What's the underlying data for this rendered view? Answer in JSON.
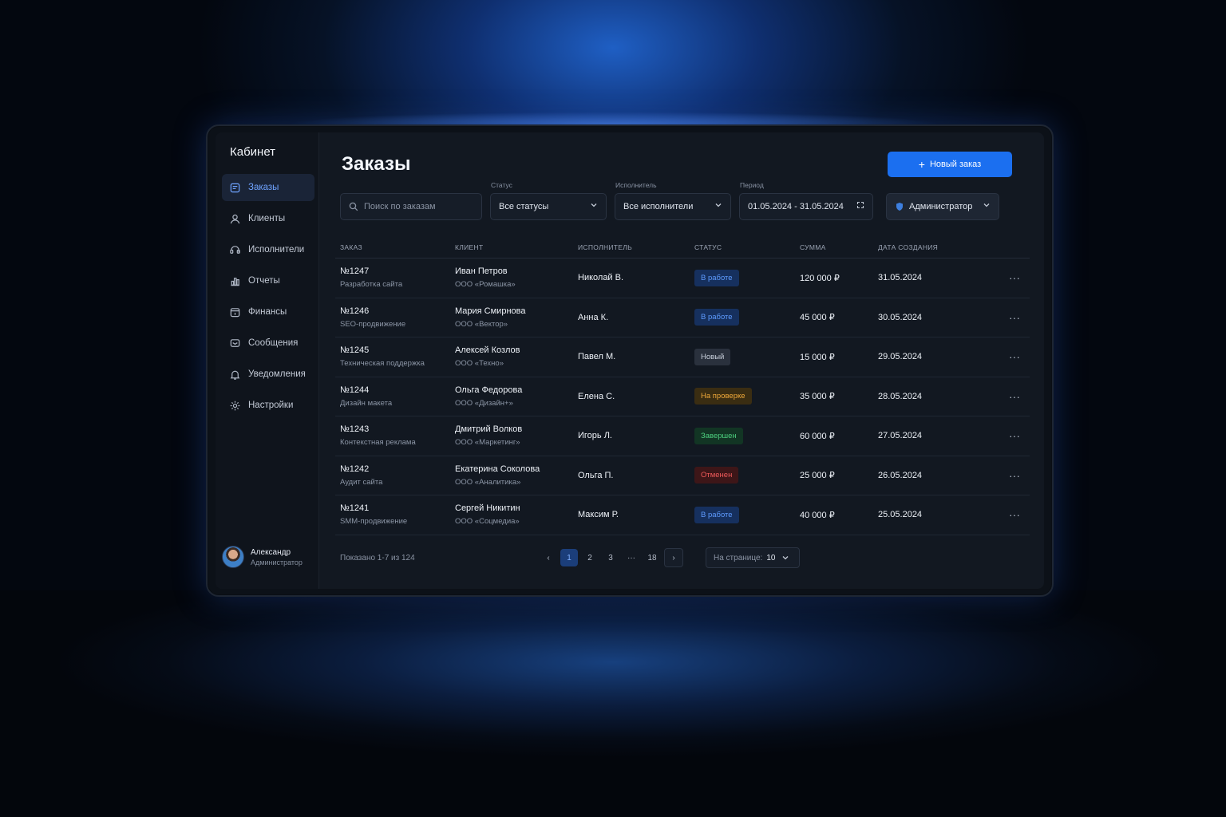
{
  "sidebar": {
    "brand": "Кабинет",
    "items": [
      {
        "label": "Заказы",
        "icon": "orders-icon",
        "active": true
      },
      {
        "label": "Клиенты",
        "icon": "clients-icon"
      },
      {
        "label": "Исполнители",
        "icon": "executors-icon"
      },
      {
        "label": "Отчеты",
        "icon": "reports-icon"
      },
      {
        "label": "Финансы",
        "icon": "finance-icon"
      },
      {
        "label": "Сообщения",
        "icon": "messages-icon"
      },
      {
        "label": "Уведомления",
        "icon": "bell-icon"
      },
      {
        "label": "Настройки",
        "icon": "gear-icon"
      }
    ],
    "user": {
      "name": "Александр",
      "role": "Администратор"
    }
  },
  "header": {
    "title": "Заказы",
    "new_button": "Новый заказ"
  },
  "filters": {
    "search_placeholder": "Поиск по заказам",
    "status_label": "Статус",
    "status_value": "Все статусы",
    "executor_label": "Исполнитель",
    "executor_value": "Все исполнители",
    "period_label": "Период",
    "period_value": "01.05.2024 - 31.05.2024",
    "role_value": "Администратор"
  },
  "table": {
    "columns": [
      "ЗАКАЗ",
      "КЛИЕНТ",
      "ИСПОЛНИТЕЛЬ",
      "СТАТУС",
      "СУММА",
      "ДАТА СОЗДАНИЯ"
    ],
    "rows": [
      {
        "id": "№1247",
        "desc": "Разработка сайта",
        "client": "Иван Петров",
        "company": "ООО «Ромашка»",
        "executor": "Николай В.",
        "status": "В работе",
        "amount": "120 000 ₽",
        "date": "31.05.2024"
      },
      {
        "id": "№1246",
        "desc": "SEO-продвижение",
        "client": "Мария Смирнова",
        "company": "ООО «Вектор»",
        "executor": "Анна К.",
        "status": "В работе",
        "amount": "45 000 ₽",
        "date": "30.05.2024"
      },
      {
        "id": "№1245",
        "desc": "Техническая поддержка",
        "client": "Алексей Козлов",
        "company": "ООО «Техно»",
        "executor": "Павел М.",
        "status": "Новый",
        "amount": "15 000 ₽",
        "date": "29.05.2024"
      },
      {
        "id": "№1244",
        "desc": "Дизайн макета",
        "client": "Ольга Федорова",
        "company": "ООО «Дизайн+»",
        "executor": "Елена С.",
        "status": "На проверке",
        "amount": "35 000 ₽",
        "date": "28.05.2024"
      },
      {
        "id": "№1243",
        "desc": "Контекстная реклама",
        "client": "Дмитрий Волков",
        "company": "ООО «Маркетинг»",
        "executor": "Игорь Л.",
        "status": "Завершен",
        "amount": "60 000 ₽",
        "date": "27.05.2024"
      },
      {
        "id": "№1242",
        "desc": "Аудит сайта",
        "client": "Екатерина Соколова",
        "company": "ООО «Аналитика»",
        "executor": "Ольга П.",
        "status": "Отменен",
        "amount": "25 000 ₽",
        "date": "26.05.2024"
      },
      {
        "id": "№1241",
        "desc": "SMM-продвижение",
        "client": "Сергей Никитин",
        "company": "ООО «Соцмедиа»",
        "executor": "Максим Р.",
        "status": "В работе",
        "amount": "40 000 ₽",
        "date": "25.05.2024"
      }
    ]
  },
  "status_colors": {
    "В работе": {
      "bg": "#16305e",
      "fg": "#5e9bff"
    },
    "Новый": {
      "bg": "#2a313d",
      "fg": "#c9d0dc"
    },
    "На проверке": {
      "bg": "#3a2d12",
      "fg": "#f0a93a"
    },
    "Завершен": {
      "bg": "#123524",
      "fg": "#4ccf7e"
    },
    "Отменен": {
      "bg": "#3d1618",
      "fg": "#f05a5a"
    }
  },
  "pagination": {
    "info": "Показано 1-7 из 124",
    "pages": [
      "1",
      "2",
      "3",
      "···",
      "18"
    ],
    "per_page_label": "На странице:",
    "per_page_value": "10"
  },
  "colors": {
    "accent": "#1b6ff0"
  }
}
